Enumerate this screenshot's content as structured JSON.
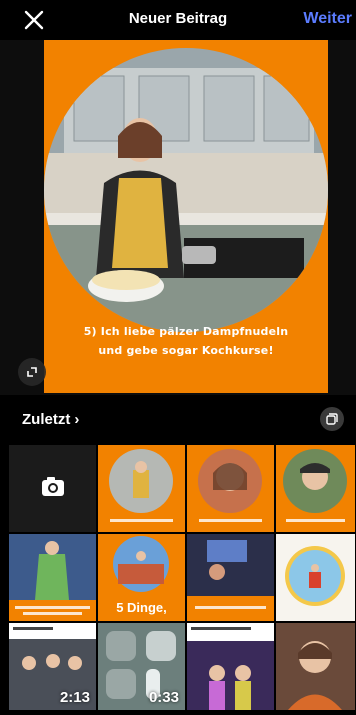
{
  "header": {
    "title": "Neuer Beitrag",
    "next_label": "Weiter"
  },
  "preview": {
    "caption_line1": "5) Ich liebe pälzer Dampfnudeln",
    "caption_line2": "und gebe sogar Kochkurse!",
    "accent_color": "#f28200"
  },
  "recents": {
    "label": "Zuletzt",
    "chevron": "›"
  },
  "gallery": {
    "items": [
      {
        "kind": "camera"
      },
      {
        "kind": "photo",
        "overlay": ""
      },
      {
        "kind": "photo",
        "overlay": ""
      },
      {
        "kind": "photo",
        "overlay": ""
      },
      {
        "kind": "photo",
        "overlay": ""
      },
      {
        "kind": "photo",
        "overlay": "5 Dinge,"
      },
      {
        "kind": "photo",
        "overlay": ""
      },
      {
        "kind": "photo",
        "overlay": ""
      },
      {
        "kind": "video",
        "duration": "2:13"
      },
      {
        "kind": "video",
        "duration": "0:33"
      },
      {
        "kind": "photo",
        "overlay": ""
      },
      {
        "kind": "photo",
        "overlay": ""
      }
    ]
  },
  "icons": {
    "close": "close-icon",
    "expand": "expand-icon",
    "multi_select": "multi-select-icon",
    "camera": "camera-icon"
  }
}
